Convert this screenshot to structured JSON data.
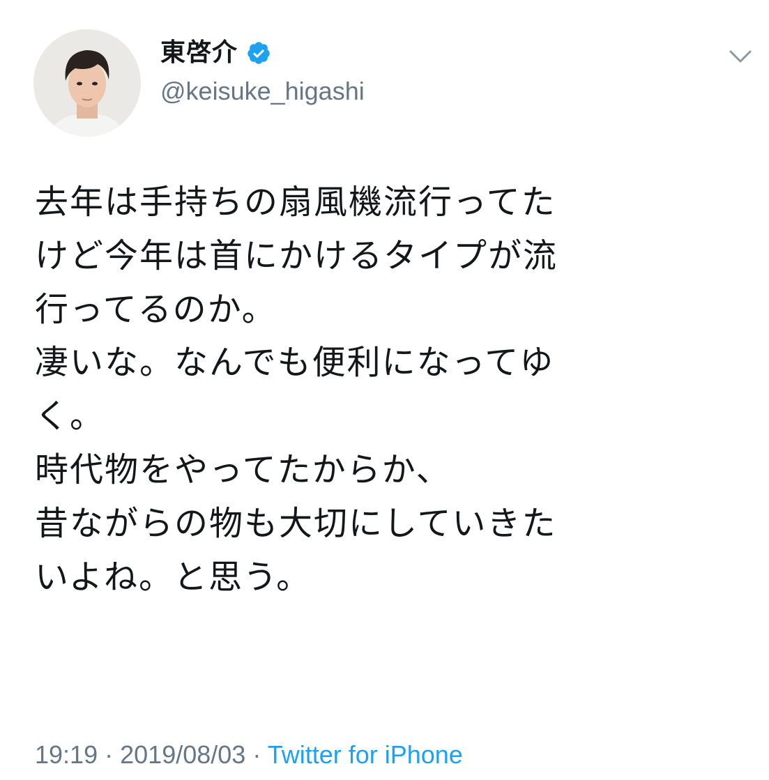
{
  "profile": {
    "display_name": "東啓介",
    "handle": "@keisuke_higashi",
    "verified_icon": "verified-badge-icon",
    "menu_icon": "chevron-down-icon"
  },
  "tweet": {
    "lines": [
      "去年は手持ちの扇風機流行ってた",
      "けど今年は首にかけるタイプが流",
      "行ってるのか。",
      "凄いな。なんでも便利になってゆ",
      "く。",
      "時代物をやってたからか、",
      "昔ながらの物も大切にしていきた",
      "いよね。と思う。"
    ]
  },
  "meta": {
    "time": "19:19",
    "separator": "·",
    "date": "2019/08/03",
    "source": "Twitter for iPhone"
  },
  "colors": {
    "text": "#14171a",
    "secondary": "#657786",
    "link": "#1da1f2",
    "verified": "#1da1f2"
  }
}
